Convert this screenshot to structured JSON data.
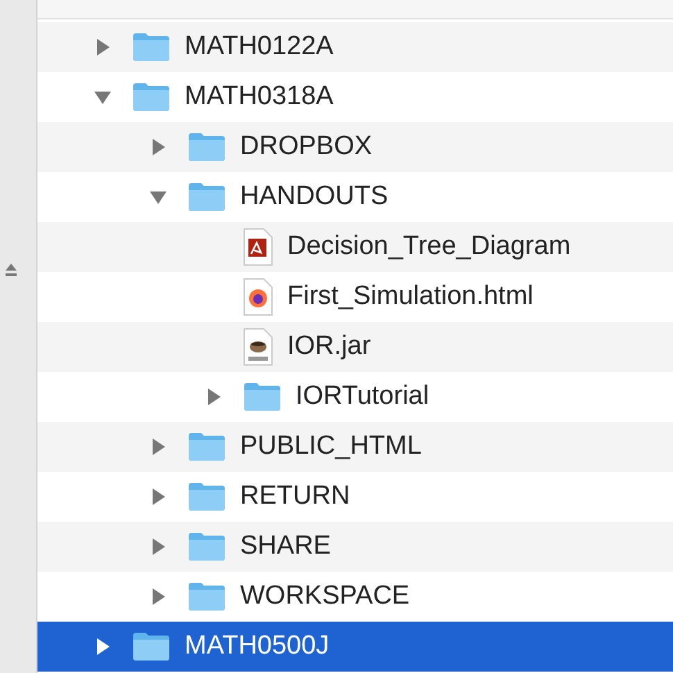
{
  "tree": [
    {
      "name": "MATH0122A",
      "kind": "folder",
      "expanded": false,
      "selected": false
    },
    {
      "name": "MATH0318A",
      "kind": "folder",
      "expanded": true,
      "selected": false,
      "children": [
        {
          "name": "DROPBOX",
          "kind": "folder",
          "expanded": false,
          "selected": false
        },
        {
          "name": "HANDOUTS",
          "kind": "folder",
          "expanded": true,
          "selected": false,
          "children": [
            {
              "name": "Decision_Tree_Diagram",
              "kind": "pdf",
              "selected": false
            },
            {
              "name": "First_Simulation.html",
              "kind": "html",
              "selected": false
            },
            {
              "name": "IOR.jar",
              "kind": "jar",
              "selected": false
            },
            {
              "name": "IORTutorial",
              "kind": "folder",
              "expanded": false,
              "selected": false
            }
          ]
        },
        {
          "name": "PUBLIC_HTML",
          "kind": "folder",
          "expanded": false,
          "selected": false
        },
        {
          "name": "RETURN",
          "kind": "folder",
          "expanded": false,
          "selected": false
        },
        {
          "name": "SHARE",
          "kind": "folder",
          "expanded": false,
          "selected": false
        },
        {
          "name": "WORKSPACE",
          "kind": "folder",
          "expanded": false,
          "selected": false
        }
      ]
    },
    {
      "name": "MATH0500J",
      "kind": "folder",
      "expanded": false,
      "selected": true
    }
  ]
}
